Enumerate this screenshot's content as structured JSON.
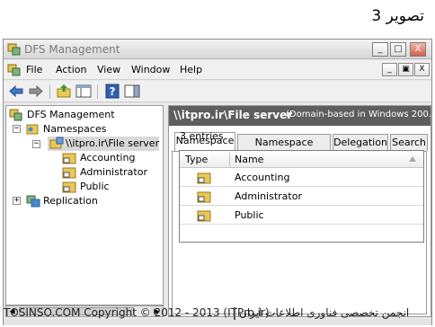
{
  "caption": "تصویر 3",
  "window": {
    "title": "DFS Management",
    "minimize": "_",
    "maximize": "□",
    "close": "X"
  },
  "menu": {
    "items": [
      "File",
      "Action",
      "View",
      "Window",
      "Help"
    ],
    "mdi_min": "_",
    "mdi_restore": "▣",
    "mdi_close": "X"
  },
  "toolbar": {
    "icons": [
      "back-arrow-icon",
      "forward-arrow-icon",
      "up-folder-icon",
      "show-hide-tree-icon",
      "help-icon",
      "action-pane-icon"
    ]
  },
  "tree": {
    "root": "DFS Management",
    "namespaces": "Namespaces",
    "namespace_node": "\\\\itpro.ir\\File server",
    "children": [
      "Accounting",
      "Administrator",
      "Public"
    ],
    "replication": "Replication",
    "collapse_glyph": "−",
    "expand_glyph": "+"
  },
  "details": {
    "header_title": "\\\\itpro.ir\\File server",
    "header_subtitle": "(Domain-based in Windows 200...",
    "tabs": [
      "Namespace",
      "Namespace Servers",
      "Delegation",
      "Search"
    ],
    "entries_count": "3 entries",
    "columns": [
      "Type",
      "Name"
    ],
    "rows": [
      "Accounting",
      "Administrator",
      "Public"
    ]
  },
  "footer": {
    "left_text": "TOSINSO.COM  Copyright © 2012 - 2013 (ITPro.ir)",
    "right_text": "انجمن تخصصی فناوری اطلاعات ایران"
  },
  "colors": {
    "header_bg": "#5e5e5e",
    "selection": "#d9d9d9",
    "folder": "#e9c85a"
  }
}
